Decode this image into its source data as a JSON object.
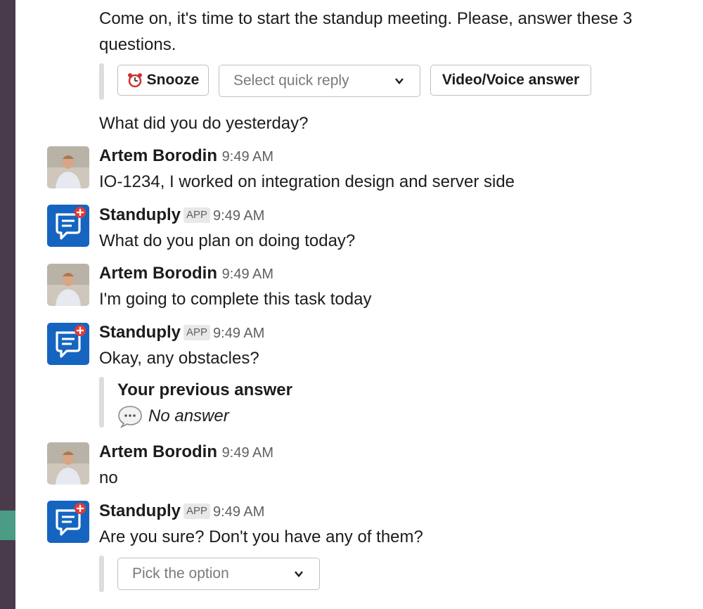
{
  "intro": {
    "text": "Come on, it's time to start the standup meeting. Please, answer these 3 questions."
  },
  "actions": {
    "snooze_label": "Snooze",
    "quick_reply_placeholder": "Select quick reply",
    "video_voice_label": "Video/Voice answer"
  },
  "question_yesterday": "What did you do yesterday?",
  "messages": [
    {
      "author": "Artem Borodin",
      "time": "9:49 AM",
      "text": "IO-1234, I worked on integration design and server side"
    },
    {
      "author": "Standuply",
      "badge": "APP",
      "time": "9:49 AM",
      "text": "What do you plan on doing today?"
    },
    {
      "author": "Artem Borodin",
      "time": "9:49 AM",
      "text": "I'm going to complete this task today"
    },
    {
      "author": "Standuply",
      "badge": "APP",
      "time": "9:49 AM",
      "text": "Okay, any obstacles?"
    },
    {
      "author": "Artem Borodin",
      "time": "9:49 AM",
      "text": "no"
    },
    {
      "author": "Standuply",
      "badge": "APP",
      "time": "9:49 AM",
      "text": "Are you sure? Don't you have any of them?"
    }
  ],
  "previous_answer": {
    "title": "Your previous answer",
    "value": "No answer"
  },
  "pick_option_placeholder": "Pick the option",
  "colors": {
    "sidebar": "#4a3a4c",
    "sidebar_active": "#4a9c84",
    "app_blue": "#1565c0",
    "app_badge_red": "#e53935"
  }
}
